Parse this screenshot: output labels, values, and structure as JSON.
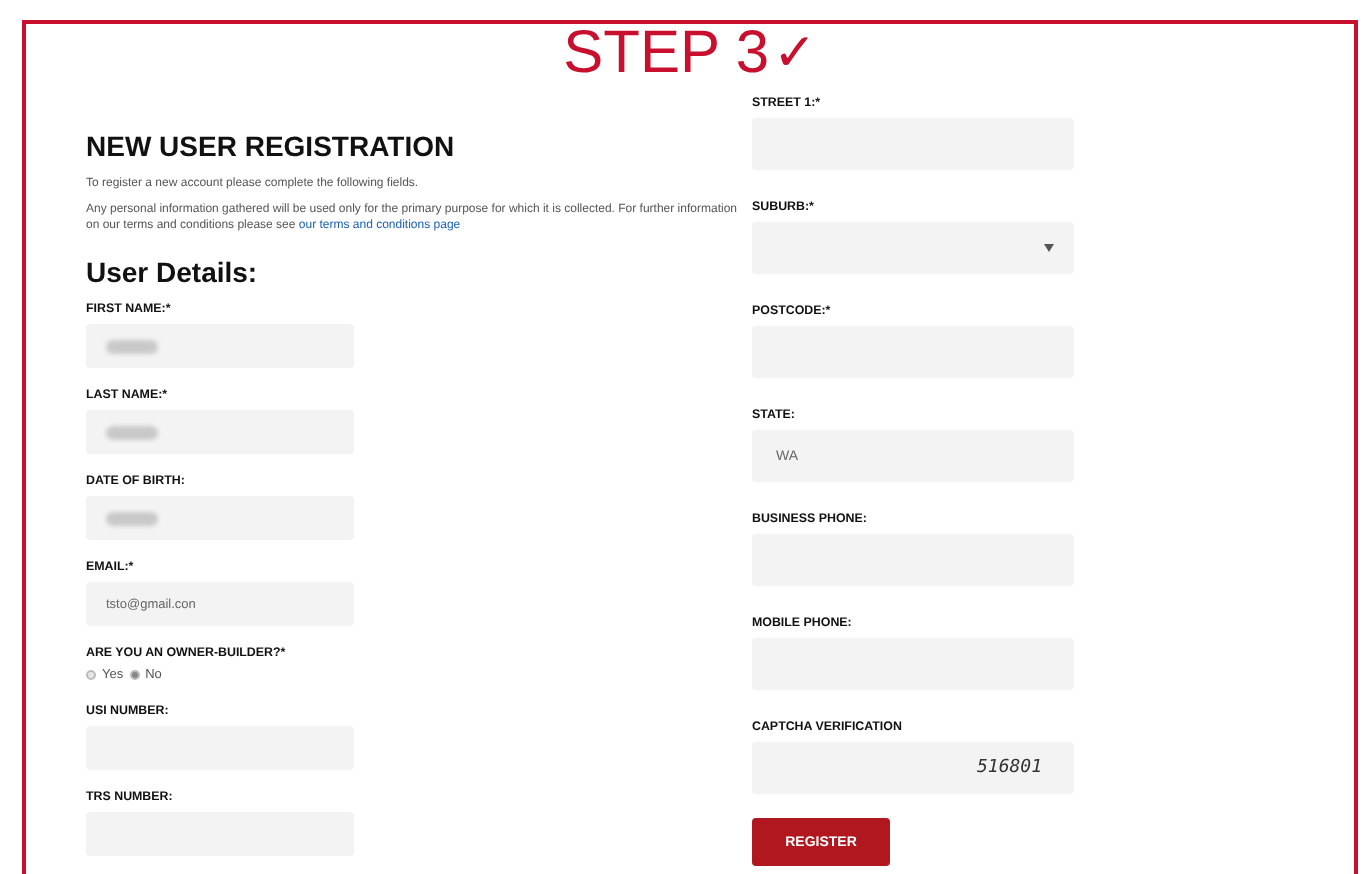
{
  "title": {
    "text": "STEP 3",
    "mark": "✓"
  },
  "heading": "NEW USER REGISTRATION",
  "intro": "To register a new account please complete the following fields.",
  "privacy": {
    "text": "Any personal information gathered will be used only for the primary purpose for which it is collected. For further information on our terms and conditions please see",
    "link": "our terms and conditions page"
  },
  "section": "User Details:",
  "left_fields": [
    {
      "kind": "text",
      "label": "FIRST NAME:*",
      "redacted": true
    },
    {
      "kind": "text",
      "label": "LAST NAME:*",
      "redacted": true
    },
    {
      "kind": "text",
      "label": "DATE OF BIRTH:",
      "redacted": true
    },
    {
      "kind": "text",
      "label": "EMAIL:*",
      "value": "tsto@gmail.con",
      "redacted": false
    },
    {
      "kind": "radio",
      "label": "ARE YOU AN OWNER-BUILDER?*",
      "options": [
        {
          "label": "Yes",
          "selected": false
        },
        {
          "label": "No",
          "selected": true
        }
      ]
    },
    {
      "kind": "text",
      "label": "USI NUMBER:",
      "redacted": false
    },
    {
      "kind": "text",
      "label": "TRS NUMBER:",
      "redacted": false
    }
  ],
  "right_fields": [
    {
      "kind": "text",
      "label": "STREET 1:*"
    },
    {
      "kind": "select",
      "label": "SUBURB:*"
    },
    {
      "kind": "text",
      "label": "POSTCODE:*"
    },
    {
      "kind": "text",
      "label": "STATE:",
      "value": "WA"
    },
    {
      "kind": "text",
      "label": "BUSINESS PHONE:"
    },
    {
      "kind": "text",
      "label": "MOBILE PHONE:"
    },
    {
      "kind": "captcha",
      "label": "CAPTCHA VERIFICATION",
      "code": "516801"
    }
  ],
  "button": "REGISTER"
}
